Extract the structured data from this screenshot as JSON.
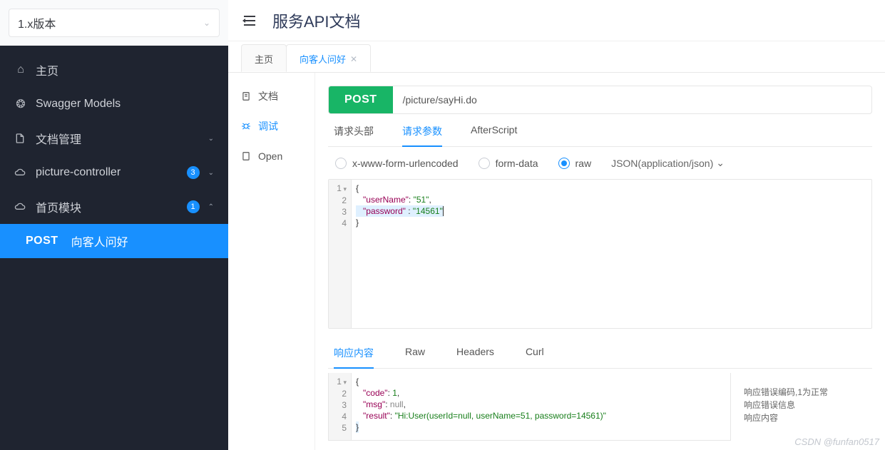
{
  "version_selector": "1.x版本",
  "header_title": "服务API文档",
  "nav": {
    "home": "主页",
    "swagger": "Swagger Models",
    "doc_mgmt": "文档管理",
    "picture_controller": {
      "label": "picture-controller",
      "badge": "3"
    },
    "home_module": {
      "label": "首页模块",
      "badge": "1"
    },
    "sub_method": "POST",
    "sub_label": "向客人问好"
  },
  "tabs": {
    "main": "主页",
    "greet": "向客人问好"
  },
  "side_tabs": {
    "doc": "文档",
    "debug": "调试",
    "open": "Open"
  },
  "request": {
    "method": "POST",
    "path": "/picture/sayHi.do",
    "tabs": {
      "headers": "请求头部",
      "params": "请求参数",
      "after": "AfterScript"
    },
    "body_types": {
      "urlenc": "x-www-form-urlencoded",
      "formdata": "form-data",
      "raw": "raw"
    },
    "content_type": "JSON(application/json)",
    "editor_lines": [
      "1",
      "2",
      "3",
      "4"
    ],
    "body": {
      "l1": "{",
      "l2_key": "\"userName\"",
      "l2_val": "\"51\"",
      "l3_key": "\"password\"",
      "l3_val": "\"14561\"",
      "l4": "}"
    }
  },
  "response": {
    "tabs": {
      "content": "响应内容",
      "raw": "Raw",
      "headers": "Headers",
      "curl": "Curl"
    },
    "editor_lines": [
      "1",
      "2",
      "3",
      "4",
      "5"
    ],
    "body": {
      "l1": "{",
      "l2_key": "\"code\"",
      "l2_val": "1",
      "l3_key": "\"msg\"",
      "l3_val": "null",
      "l4_key": "\"result\"",
      "l4_val": "\"Hi:User(userId=null, userName=51, password=14561)\"",
      "l5": "}"
    },
    "meta": {
      "code": "响应错误编码,1为正常",
      "msg": "响应错误信息",
      "result": "响应内容"
    }
  },
  "watermark": "CSDN @funfan0517"
}
